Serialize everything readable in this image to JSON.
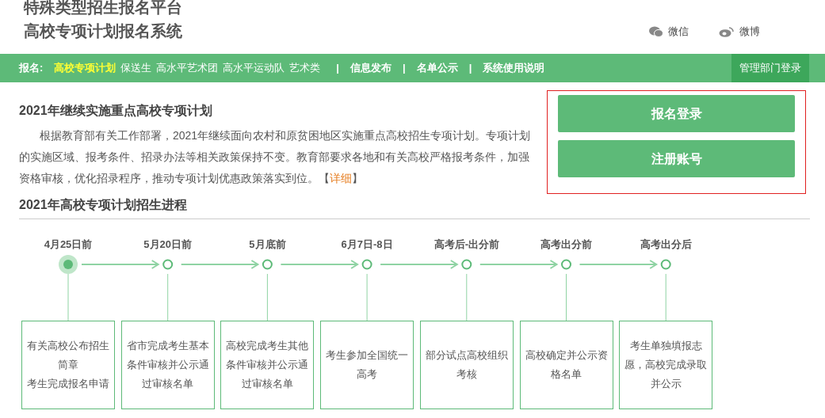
{
  "header": {
    "title_lines": [
      "特殊类型招生报名平台",
      "高校专项计划报名系统"
    ],
    "social": [
      {
        "kind": "wechat",
        "label": "微信"
      },
      {
        "kind": "weibo",
        "label": "微博"
      }
    ]
  },
  "nav": {
    "prefix": "报名:",
    "signup_items": [
      {
        "label": "高校专项计划",
        "selected": true
      },
      {
        "label": "保送生",
        "selected": false
      },
      {
        "label": "高水平艺术团",
        "selected": false
      },
      {
        "label": "高水平运动队",
        "selected": false
      },
      {
        "label": "艺术类",
        "selected": false
      }
    ],
    "main_items": [
      {
        "label": "|",
        "kind": "separator"
      },
      {
        "label": "信息发布",
        "kind": "link"
      },
      {
        "label": "|",
        "kind": "separator"
      },
      {
        "label": "名单公示",
        "kind": "link"
      },
      {
        "label": "|",
        "kind": "separator"
      },
      {
        "label": "系统使用说明",
        "kind": "link"
      }
    ],
    "admin_login": "管理部门登录"
  },
  "intro": {
    "title": "2021年继续实施重点高校专项计划",
    "text": "根据教育部有关工作部署，2021年继续面向农村和原贫困地区实施重点高校招生专项计划。专项计划的实施区域、报考条件、招录办法等相关政策保持不变。教育部要求各地和有关高校严格报考条件，加强资格审核，优化招录程序，推动专项计划优惠政策落实到位。",
    "link_open": "【",
    "link": "详细",
    "link_close": "】"
  },
  "actions": {
    "highlighted": true,
    "buttons": [
      "报名登录",
      "注册账号"
    ]
  },
  "process": {
    "title": "2021年高校专项计划招生进程",
    "steps": [
      {
        "date": "4月25日前",
        "current": true,
        "lines": [
          "有关高校公布招生简章",
          "考生完成报名申请"
        ]
      },
      {
        "date": "5月20日前",
        "current": false,
        "lines": [
          "省市完成考生基本条件审核并公示通过审核名单"
        ]
      },
      {
        "date": "5月底前",
        "current": false,
        "lines": [
          "高校完成考生其他条件审核并公示通过审核名单"
        ]
      },
      {
        "date": "6月7日-8日",
        "current": false,
        "lines": [
          "考生参加全国统一高考"
        ]
      },
      {
        "date": "高考后-出分前",
        "current": false,
        "lines": [
          "部分试点高校组织考核"
        ]
      },
      {
        "date": "高考出分前",
        "current": false,
        "lines": [
          "高校确定并公示资格名单"
        ]
      },
      {
        "date": "高考出分后",
        "current": false,
        "lines": [
          "考生单独填报志愿，高校完成录取并公示"
        ]
      }
    ]
  }
}
